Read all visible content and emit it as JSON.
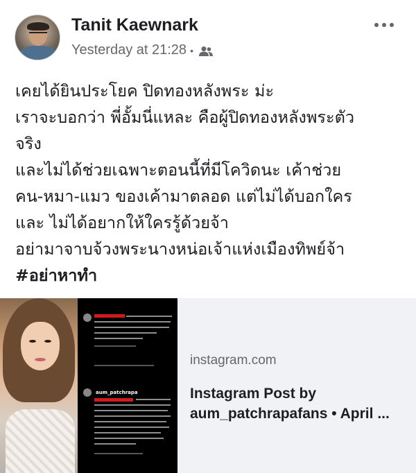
{
  "post": {
    "author": "Tanit Kaewnark",
    "timestamp": "Yesterday at 21:28",
    "separator": "•",
    "audience_icon": "friends-icon",
    "more_icon": "more-horizontal-icon",
    "text_lines": [
      "เคยได้ยินประโยค ปิดทองหลังพระ ม่ะ",
      "เราจะบอกว่า พี่อั้มนี่แหละ คือผู้ปิดทองหลังพระตัว",
      "จริง",
      "และไม่ได้ช่วยเฉพาะตอนนี้ที่มีโควิดนะ เค้าช่วย",
      "คน-หมา-แมว ของเค้ามาตลอด แต่ไม่ได้บอกใคร",
      "และ ไม่ได้อยากให้ใครรู้ด้วยจ้า",
      "อย่ามาจาบจ้วงพระนางหน่อเจ้าแห่งเมืองทิพย์จ้า"
    ],
    "hashtag": "#อย่าหาทำ"
  },
  "link_card": {
    "domain": "instagram.com",
    "title_lines": [
      "Instagram Post by",
      "aum_patchrapafans • April ..."
    ],
    "screenshot": {
      "username": "aum_patchrapa"
    }
  },
  "colors": {
    "text_primary": "#1c1e21",
    "text_secondary": "#65676b",
    "card_background": "#f0f2f5",
    "redaction": "#d11b1b"
  }
}
